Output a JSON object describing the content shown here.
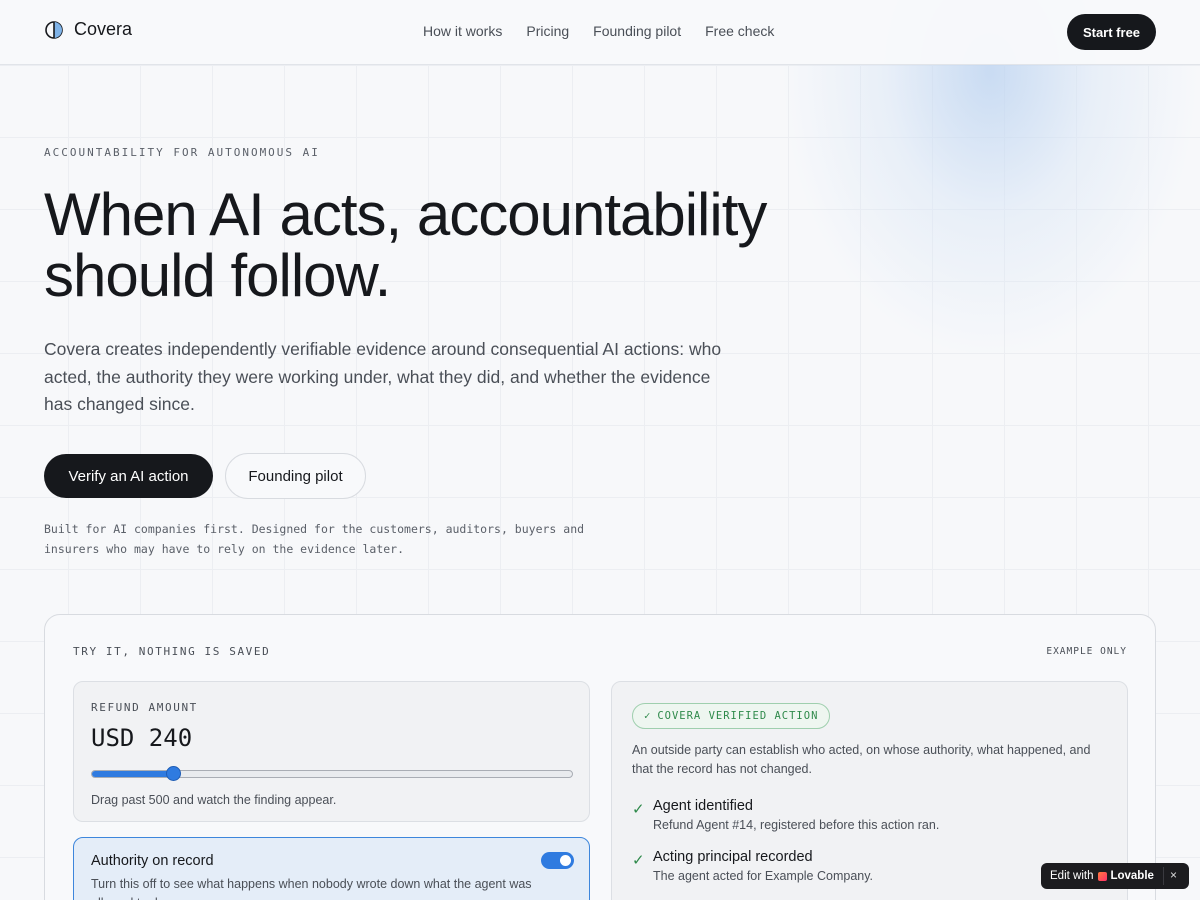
{
  "nav": {
    "brand": "Covera",
    "links": [
      "How it works",
      "Pricing",
      "Founding pilot",
      "Free check"
    ],
    "cta": "Start free"
  },
  "hero": {
    "eyebrow": "ACCOUNTABILITY FOR AUTONOMOUS AI",
    "headline_line1": "When AI acts, accountability",
    "headline_line2": "should follow.",
    "lede": "Covera creates independently verifiable evidence around consequential AI actions: who acted, the authority they were working under, what they did, and whether the evidence has changed since.",
    "primary_cta": "Verify an AI action",
    "secondary_cta": "Founding pilot",
    "built_for": "Built for AI companies first. Designed for the customers, auditors, buyers and insurers who may have to rely on the evidence later."
  },
  "demo": {
    "label": "TRY IT, NOTHING IS SAVED",
    "example_tag": "EXAMPLE ONLY",
    "refund": {
      "label": "REFUND AMOUNT",
      "value": "USD 240",
      "slider_fraction": 0.17,
      "hint": "Drag past 500 and watch the finding appear."
    },
    "authority": {
      "title": "Authority on record",
      "description": "Turn this off to see what happens when nobody wrote down what the agent was allowed to do.",
      "enabled": true
    },
    "verified": {
      "badge": "COVERA VERIFIED ACTION",
      "badge_icon": "checkmark-icon",
      "description": "An outside party can establish who acted, on whose authority, what happened, and that the record has not changed.",
      "checks": [
        {
          "title": "Agent identified",
          "detail": "Refund Agent #14, registered before this action ran."
        },
        {
          "title": "Acting principal recorded",
          "detail": "The agent acted for Example Company."
        }
      ]
    }
  },
  "badge": {
    "edit_with": "Edit with",
    "brand": "Lovable",
    "close": "×"
  },
  "colors": {
    "ink": "#16181c",
    "accent_blue": "#2f7be0",
    "verified_green": "#2f8a4b"
  }
}
